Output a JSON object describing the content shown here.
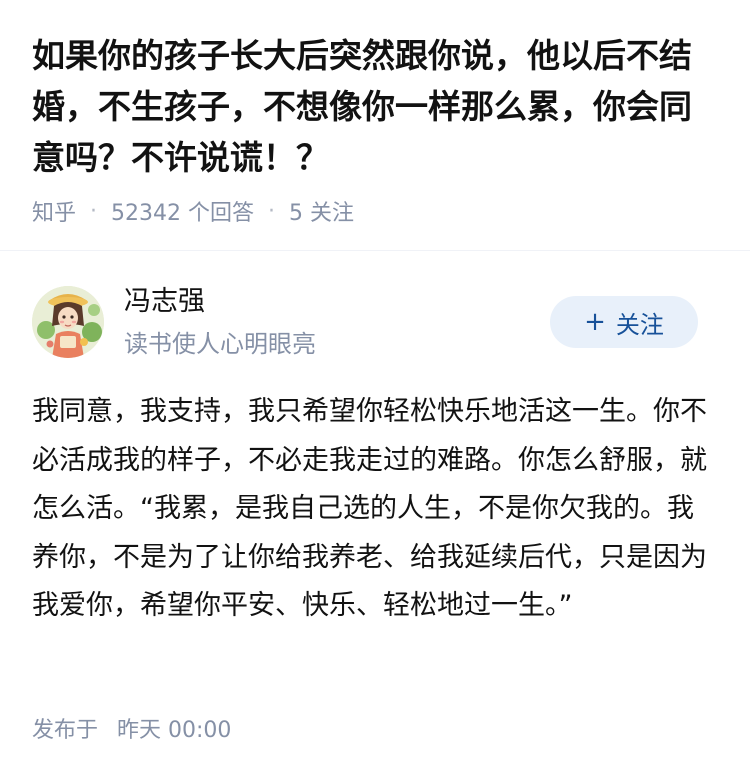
{
  "question": {
    "title": "如果你的孩子长大后突然跟你说，他以后不结婚，不生孩子，不想像你一样那么累，你会同意吗？不许说谎！？",
    "source": "知乎",
    "answer_count": "52342 个回答",
    "follow_count": "5 关注"
  },
  "author": {
    "name": "冯志强",
    "bio": "读书使人心明眼亮",
    "follow_label": "关注",
    "follow_icon": "plus-icon",
    "avatar_icon": "illustrated-girl-avatar"
  },
  "answer": {
    "text": "我同意，我支持，我只希望你轻松快乐地活这一生。你不必活成我的样子，不必走我走过的难路。你怎么舒服，就怎么活。“我累，是我自己选的人生，不是你欠我的。我养你，不是为了让你给我养老、给我延续后代，只是因为我爱你，希望你平安、快乐、轻松地过一生。”"
  },
  "published": {
    "label": "发布于",
    "time": "昨天 00:00"
  },
  "colors": {
    "text_primary": "#121212",
    "text_secondary": "#8590a6",
    "accent_blue": "#175199",
    "follow_bg": "#e8f0fa"
  }
}
